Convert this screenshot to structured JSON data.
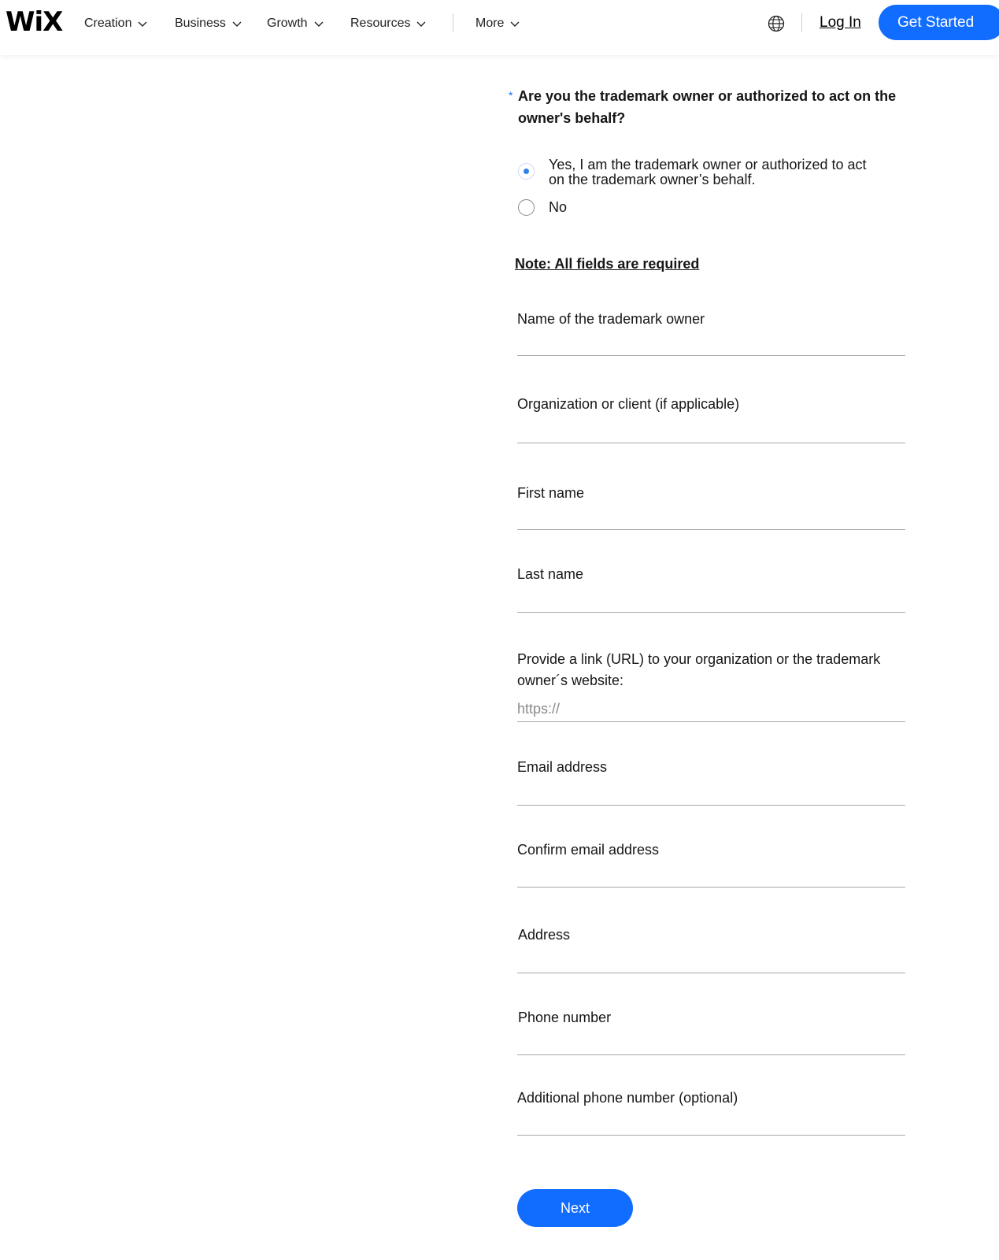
{
  "header": {
    "logo": "WiX",
    "nav": [
      "Creation",
      "Business",
      "Growth",
      "Resources",
      "More"
    ],
    "login": "Log In",
    "get_started": "Get Started"
  },
  "form": {
    "question": "Are you the trademark owner or authorized to act on the owner's behalf?",
    "options": [
      {
        "label_line1": "Yes, I am the trademark owner or authorized to act",
        "label_line2": "on the trademark owner’s behalf.",
        "selected": true
      },
      {
        "label_line1": "No",
        "label_line2": "",
        "selected": false
      }
    ],
    "note": "Note: All fields are required",
    "fields": [
      {
        "label": "Name of the trademark owner",
        "placeholder": ""
      },
      {
        "label": "Organization or client (if applicable)",
        "placeholder": ""
      },
      {
        "label": "First name",
        "placeholder": ""
      },
      {
        "label": "Last name",
        "placeholder": ""
      },
      {
        "label": "Provide a link (URL) to your organization or the trademark owner´s website:",
        "placeholder": "https://"
      },
      {
        "label": "Email address",
        "placeholder": ""
      },
      {
        "label": "Confirm email address",
        "placeholder": ""
      },
      {
        "label": "Address",
        "placeholder": ""
      },
      {
        "label": "Phone number",
        "placeholder": ""
      },
      {
        "label": "Additional phone number (optional)",
        "placeholder": ""
      }
    ],
    "next": "Next"
  },
  "colors": {
    "accent": "#116dff",
    "radio_selected": "#2f80ed"
  },
  "icons": {
    "language": "globe-icon",
    "dropdown": "chevron-down-icon"
  }
}
